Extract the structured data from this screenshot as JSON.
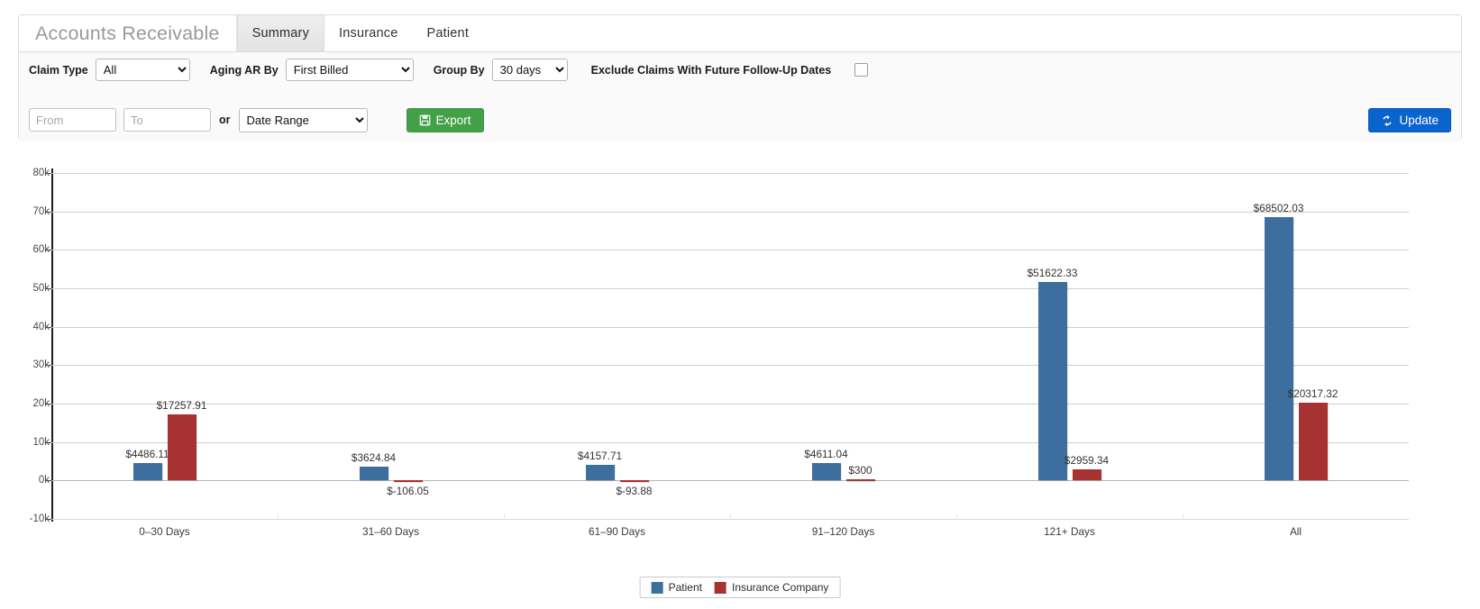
{
  "header": {
    "title": "Accounts Receivable",
    "tabs": [
      {
        "label": "Summary",
        "active": true
      },
      {
        "label": "Insurance",
        "active": false
      },
      {
        "label": "Patient",
        "active": false
      }
    ]
  },
  "filters": {
    "claim_type_label": "Claim Type",
    "claim_type_value": "All",
    "aging_ar_by_label": "Aging AR By",
    "aging_ar_by_value": "First Billed",
    "group_by_label": "Group By",
    "group_by_value": "30 days",
    "exclude_label": "Exclude Claims With Future Follow-Up Dates",
    "exclude_checked": false,
    "from_placeholder": "From",
    "from_value": "",
    "to_placeholder": "To",
    "to_value": "",
    "or_label": "or",
    "date_range_value": "Date Range",
    "export_label": "Export",
    "export_icon": "save-disk-icon",
    "update_label": "Update",
    "update_icon": "refresh-icon"
  },
  "colors": {
    "patient": "#3c6e9e",
    "insurance": "#a63232",
    "export_button": "#43a047",
    "update_button": "#0b63ce"
  },
  "chart_data": {
    "type": "bar",
    "title": "",
    "xlabel": "",
    "ylabel": "",
    "ylim": [
      -10000,
      80000
    ],
    "grid": true,
    "legend_position": "bottom",
    "categories": [
      "0–30 Days",
      "31–60 Days",
      "61–90 Days",
      "91–120 Days",
      "121+ Days",
      "All"
    ],
    "ytick_labels": [
      "80k",
      "70k",
      "60k",
      "50k",
      "40k",
      "30k",
      "20k",
      "10k",
      "0k",
      "-10k"
    ],
    "ytick_values": [
      80000,
      70000,
      60000,
      50000,
      40000,
      30000,
      20000,
      10000,
      0,
      -10000
    ],
    "series": [
      {
        "name": "Patient",
        "color": "#3c6e9e",
        "values": [
          4486.11,
          3624.84,
          4157.71,
          4611.04,
          51622.33,
          68502.03
        ],
        "labels": [
          "$4486.11",
          "$3624.84",
          "$4157.71",
          "$4611.04",
          "$51622.33",
          "$68502.03"
        ]
      },
      {
        "name": "Insurance Company",
        "color": "#a63232",
        "values": [
          17257.91,
          -106.05,
          -93.88,
          300,
          2959.34,
          20317.32
        ],
        "labels": [
          "$17257.91",
          "$-106.05",
          "$-93.88",
          "$300",
          "$2959.34",
          "$20317.32"
        ]
      }
    ]
  },
  "legend": [
    {
      "label": "Patient",
      "color": "#3c6e9e"
    },
    {
      "label": "Insurance Company",
      "color": "#a63232"
    }
  ]
}
